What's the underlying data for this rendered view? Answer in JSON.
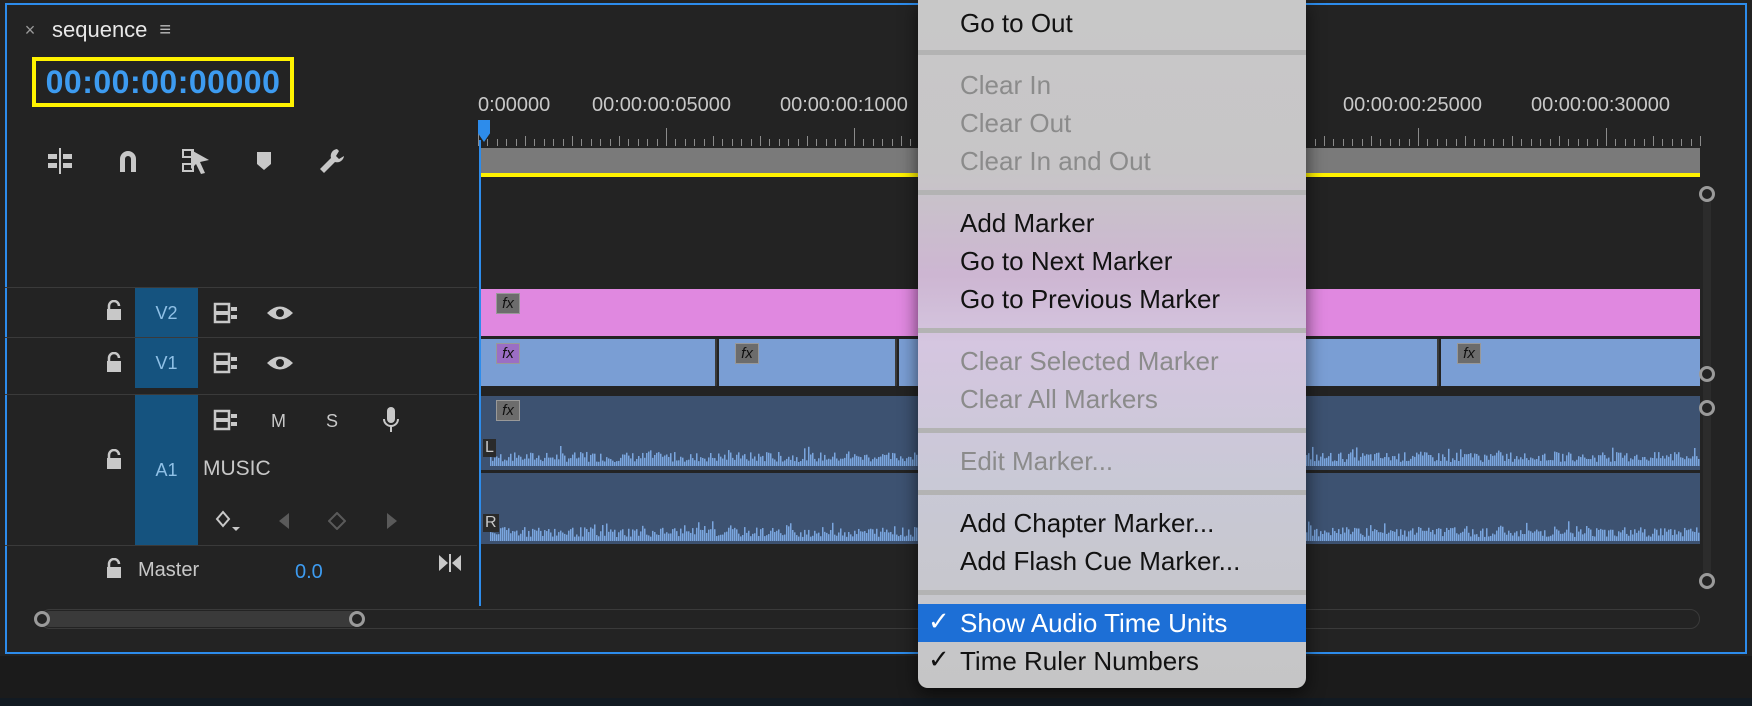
{
  "panel": {
    "close": "×",
    "title": "sequence",
    "menu_glyph": "≡",
    "timecode": "00:00:00:00000"
  },
  "ruler": {
    "labels": [
      "0:00000",
      "00:00:00:05000",
      "00:00:00:1000",
      "00:00:00:25000",
      "00:00:00:30000"
    ]
  },
  "tracks": {
    "v2": {
      "label": "V2"
    },
    "v1": {
      "label": "V1"
    },
    "a1": {
      "label": "A1",
      "name": "MUSIC",
      "m": "M",
      "s": "S",
      "ch_l": "L",
      "ch_r": "R"
    },
    "master": {
      "label": "Master",
      "value": "0.0"
    }
  },
  "fx_label": "fx",
  "menu": {
    "items": [
      {
        "label": "Go to Out",
        "enabled": true
      },
      {
        "label": "Clear In",
        "enabled": false
      },
      {
        "label": "Clear Out",
        "enabled": false
      },
      {
        "label": "Clear In and Out",
        "enabled": false
      },
      {
        "label": "Add Marker",
        "enabled": true
      },
      {
        "label": "Go to Next Marker",
        "enabled": true
      },
      {
        "label": "Go to Previous Marker",
        "enabled": true
      },
      {
        "label": "Clear Selected Marker",
        "enabled": false
      },
      {
        "label": "Clear All Markers",
        "enabled": false
      },
      {
        "label": "Edit Marker...",
        "enabled": false
      },
      {
        "label": "Add Chapter Marker...",
        "enabled": true
      },
      {
        "label": "Add Flash Cue Marker...",
        "enabled": true
      },
      {
        "label": "Show Audio Time Units",
        "enabled": true,
        "checked": true,
        "highlighted": true
      },
      {
        "label": "Time Ruler Numbers",
        "enabled": true,
        "checked": true
      }
    ],
    "check_glyph": "✓"
  },
  "colors": {
    "accent": "#2d8ceb",
    "timecode_text": "#3d9bf0",
    "timecode_border": "#fff200",
    "v2_clip": "#e088e0",
    "v1_clip": "#7a9ed4",
    "audio_clip": "#3d5271",
    "waveform": "#7aa6df",
    "track_header": "#15537f",
    "menu_highlight": "#1d6fd6"
  }
}
